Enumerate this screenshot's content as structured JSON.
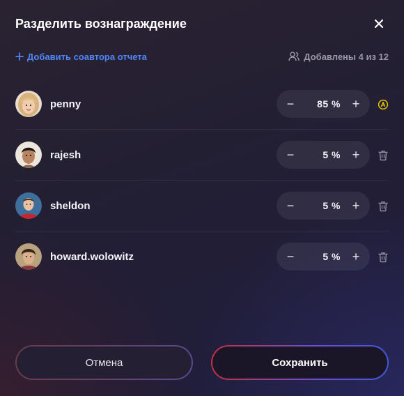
{
  "dialog": {
    "title": "Разделить вознаграждение",
    "close_icon": "close-icon"
  },
  "subbar": {
    "add_coauthor_label": "Добавить соавтора отчета",
    "added_counter": "Добавлены 4 из 12"
  },
  "participants": [
    {
      "username": "penny",
      "share": "85 %",
      "action_icon": "owner-badge-icon",
      "accent": "#e7c200"
    },
    {
      "username": "rajesh",
      "share": "5 %",
      "action_icon": "trash-icon"
    },
    {
      "username": "sheldon",
      "share": "5 %",
      "action_icon": "trash-icon"
    },
    {
      "username": "howard.wolowitz",
      "share": "5 %",
      "action_icon": "trash-icon"
    }
  ],
  "stepper": {
    "decrement_symbol": "−",
    "increment_symbol": "+"
  },
  "footer": {
    "cancel_label": "Отмена",
    "save_label": "Сохранить"
  },
  "colors": {
    "link": "#4f86f7",
    "owner_badge": "#e7c200",
    "save_gradient": [
      "#c4303f",
      "#6a4fd0",
      "#3f5ad8"
    ]
  }
}
